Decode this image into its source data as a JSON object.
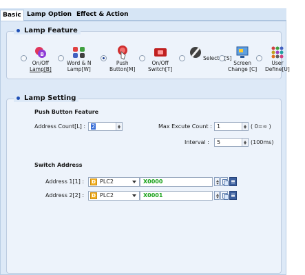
{
  "tabs": [
    {
      "label": "Basic",
      "active": true
    },
    {
      "label": "Lamp",
      "active": false
    },
    {
      "label": "Option",
      "active": false
    },
    {
      "label": "Effect & Action",
      "active": false
    }
  ],
  "lamp_feature": {
    "title": "Lamp Feature",
    "options": [
      {
        "label_line1": "On/Off",
        "label_line2": "Lamp[B]",
        "icon": "lamp-b-icon",
        "checked": false
      },
      {
        "label_line1": "Word & N",
        "label_line2": "Lamp[W]",
        "icon": "word-lamp-icon",
        "checked": false
      },
      {
        "label_line1": "Push",
        "label_line2": "Button[M]",
        "icon": "push-button-icon",
        "checked": true
      },
      {
        "label_line1": "On/Off",
        "label_line2": "Switch[T]",
        "icon": "switch-icon",
        "checked": false
      },
      {
        "label_line1": "Selector[S]",
        "label_line2": "",
        "icon": "selector-icon",
        "checked": false
      },
      {
        "label_line1": "Screen",
        "label_line2": "Change [C]",
        "icon": "screen-change-icon",
        "checked": false
      },
      {
        "label_line1": "User",
        "label_line2": "Define[U]",
        "icon": "user-define-icon",
        "checked": false
      }
    ]
  },
  "lamp_setting": {
    "title": "Lamp Setting",
    "push_button_feature": "Push Button Feature",
    "address_count_label": "Address Count[L] :",
    "address_count_value": "2",
    "max_execute_label": "Max Excute Count :",
    "max_execute_value": "1",
    "max_execute_hint": "( 0=∞ )",
    "interval_label": "Interval :",
    "interval_value": "5",
    "interval_hint": "(100ms)",
    "switch_address_title": "Switch Address",
    "addresses": [
      {
        "label": "Address 1[1] :",
        "device": "PLC2",
        "address": "X0000"
      },
      {
        "label": "Address 2[2] :",
        "device": "PLC2",
        "address": "X0001"
      }
    ]
  },
  "colors": {
    "accent": "#1e4fb5",
    "address_text": "#1aa11a",
    "device_badge": "#f5b224"
  }
}
